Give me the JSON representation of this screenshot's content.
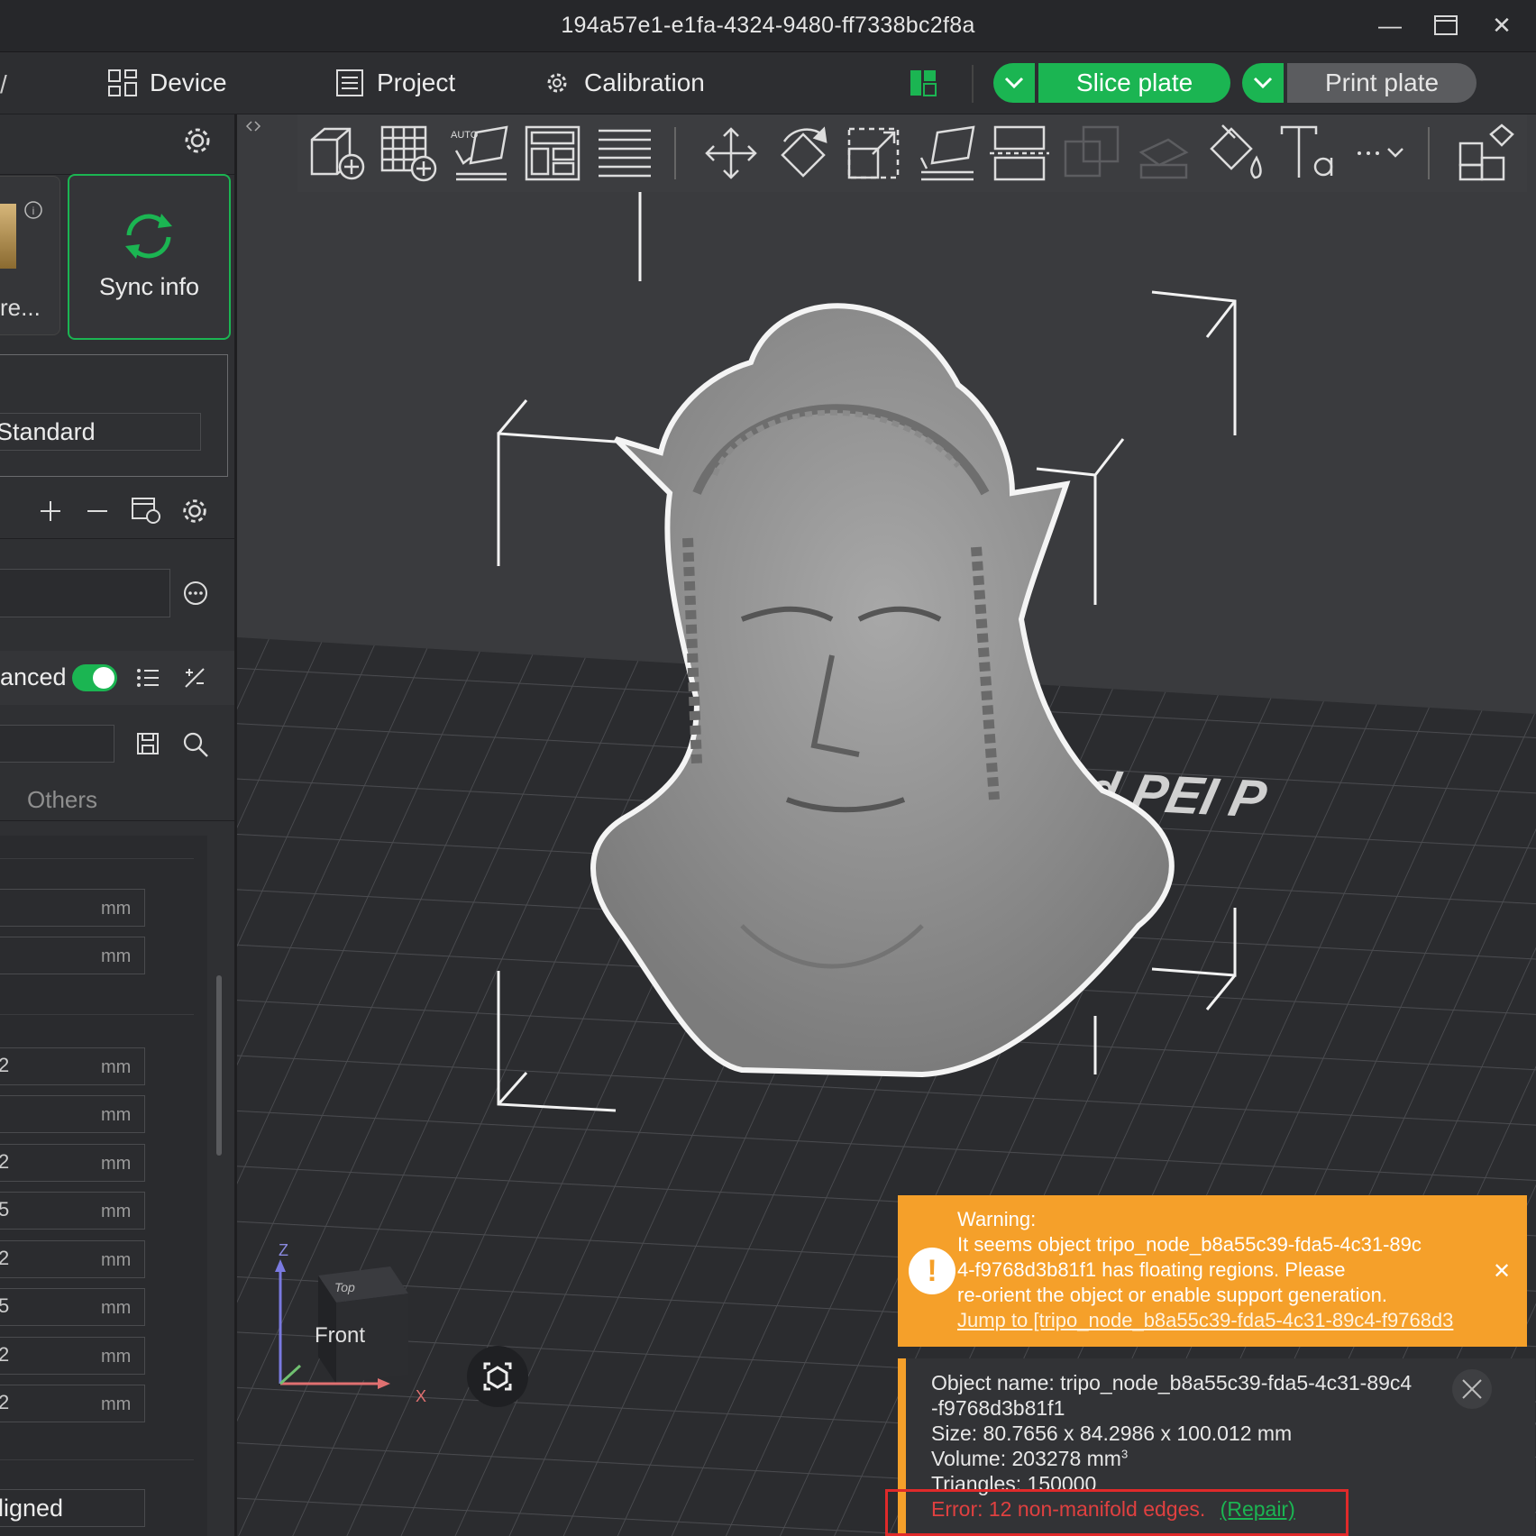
{
  "window": {
    "title": "194a57e1-e1fa-4324-9480-ff7338bc2f8a"
  },
  "menu": {
    "device": "Device",
    "project": "Project",
    "calibration": "Calibration",
    "slice_plate": "Slice plate",
    "print_plate": "Print plate"
  },
  "sidebar": {
    "truncated_card_label": "re...",
    "sync_info": "Sync info",
    "process_preset": "Standard",
    "advanced_label": "anced",
    "others_tab": "Others",
    "unit": "mm",
    "aligned_value": "ligned",
    "partial_values": [
      "2",
      "2",
      "5",
      "2",
      "5",
      "2",
      "2"
    ]
  },
  "viewport": {
    "bed_text": "extured PEI P",
    "axis_z": "Z",
    "axis_x": "X",
    "cube_top": "Top",
    "cube_front": "Front",
    "toolbar_auto_label": "AUTO"
  },
  "warning": {
    "heading": "Warning:",
    "line1": "It seems object tripo_node_b8a55c39-fda5-4c31-89c",
    "line2": "4-f9768d3b81f1 has floating regions. Please",
    "line3": "re-orient the object or enable support generation.",
    "link": "Jump to [tripo_node_b8a55c39-fda5-4c31-89c4-f9768d3"
  },
  "object_info": {
    "name_line1": "Object name: tripo_node_b8a55c39-fda5-4c31-89c4",
    "name_line2": "-f9768d3b81f1",
    "size": "Size: 80.7656 x 84.2986 x 100.012 mm",
    "volume": "Volume: 203278 mm",
    "volume_sup": "3",
    "triangles": "Triangles: 150000",
    "error": "Error: 12 non-manifold edges.",
    "repair": "(Repair)"
  },
  "colors": {
    "accent_green": "#1bb552",
    "warning_orange": "#f5a02a",
    "error_red": "#e04040"
  }
}
